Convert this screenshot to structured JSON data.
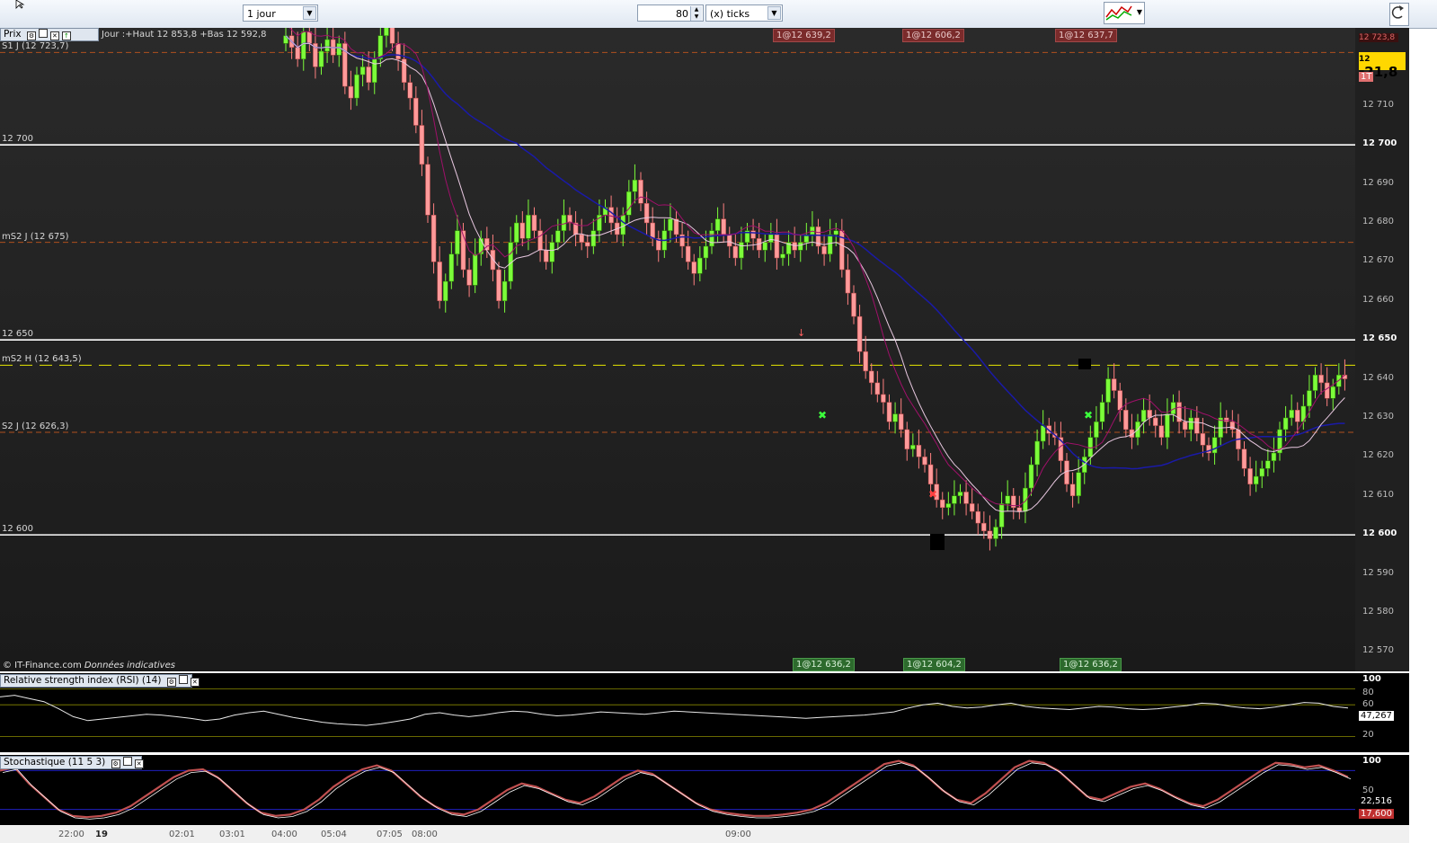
{
  "toolbar": {
    "period_select": "1 jour",
    "tick_count": "80",
    "tick_unit": "(x) ticks"
  },
  "price_panel": {
    "head_label": "Prix",
    "info": "Jour :+Haut 12 853,8 +Bas 12 592,8",
    "copyright": "© IT-Finance.com",
    "disclaimer": "Données indicatives",
    "last_price_prefix": "12 7",
    "last_price_big": "21,8",
    "top_red_value": "12 723,8",
    "timeframe_badge": "1T",
    "level_labels": [
      {
        "text": "S1 J (12 723,7)",
        "value": 12723.7
      },
      {
        "text": "12 700",
        "value": 12700
      },
      {
        "text": "mS2 J (12 675)",
        "value": 12675
      },
      {
        "text": "12 650",
        "value": 12650
      },
      {
        "text": "mS2 H (12 643,5)",
        "value": 12643.5
      },
      {
        "text": "S2 J (12 626,3)",
        "value": 12626.3
      },
      {
        "text": "12 600",
        "value": 12600
      }
    ],
    "trade_tags_top": [
      {
        "text": "1@12 639,2",
        "x_index": 119
      },
      {
        "text": "1@12 606,2",
        "x_index": 145
      },
      {
        "text": "1@12 637,7",
        "x_index": 175
      }
    ],
    "trade_tags_bottom": [
      {
        "text": "1@12 636,2",
        "x_index": 119
      },
      {
        "text": "1@12 604,2",
        "x_index": 145
      },
      {
        "text": "1@12 636,2",
        "x_index": 175
      }
    ],
    "y_ticks": [
      "12 710",
      "12 700",
      "12 690",
      "12 680",
      "12 670",
      "12 660",
      "12 650",
      "12 640",
      "12 630",
      "12 620",
      "12 610",
      "12 600",
      "12 590",
      "12 580",
      "12 570"
    ]
  },
  "rsi_panel": {
    "head_label": "Relative strength index (RSI) (14)",
    "current_value": "47,267",
    "y_ticks": [
      "100",
      "80",
      "60",
      "20"
    ]
  },
  "stoch_panel": {
    "head_label": "Stochastique (11 5 3)",
    "value_k": "22,516",
    "value_d": "17,600",
    "y_ticks": [
      "100",
      "50"
    ]
  },
  "time_axis": [
    "22:00",
    "19",
    "02:01",
    "03:01",
    "04:00",
    "05:04",
    "07:05",
    "08:00",
    "09:00"
  ],
  "chart_data": {
    "type": "candlestick",
    "ylim": [
      12565,
      12730
    ],
    "close_series": [
      12728,
      12725,
      12722,
      12729,
      12726,
      12720,
      12724,
      12727,
      12723,
      12726,
      12715,
      12712,
      12718,
      12720,
      12716,
      12722,
      12728,
      12732,
      12726,
      12722,
      12716,
      12712,
      12705,
      12695,
      12682,
      12670,
      12660,
      12665,
      12672,
      12678,
      12668,
      12664,
      12672,
      12676,
      12673,
      12668,
      12660,
      12665,
      12675,
      12680,
      12676,
      12682,
      12678,
      12673,
      12670,
      12675,
      12678,
      12682,
      12680,
      12677,
      12675,
      12674,
      12678,
      12682,
      12684,
      12680,
      12677,
      12682,
      12688,
      12691,
      12685,
      12680,
      12676,
      12673,
      12678,
      12681,
      12677,
      12674,
      12670,
      12667,
      12671,
      12674,
      12678,
      12681,
      12677,
      12674,
      12671,
      12675,
      12678,
      12676,
      12673,
      12675,
      12677,
      12671,
      12672,
      12675,
      12673,
      12675,
      12677,
      12679,
      12674,
      12672,
      12677,
      12678,
      12668,
      12662,
      12656,
      12647,
      12642,
      12639,
      12636,
      12634,
      12629,
      12631,
      12627,
      12622,
      12623,
      12620,
      12618,
      12613,
      12609,
      12607,
      12608,
      12610,
      12611,
      12608,
      12606,
      12603,
      12601,
      12599,
      12602,
      12608,
      12610,
      12607,
      12606,
      12612,
      12618,
      12624,
      12628,
      12626,
      12625,
      12619,
      12613,
      12610,
      12616,
      12620,
      12625,
      12629,
      12634,
      12640,
      12637,
      12632,
      12627,
      12625,
      12629,
      12632,
      12630,
      12628,
      12625,
      12631,
      12634,
      12629,
      12627,
      12630,
      12626,
      12623,
      12621,
      12625,
      12630,
      12629,
      12627,
      12622,
      12617,
      12613,
      12615,
      12617,
      12619,
      12621,
      12627,
      12630,
      12632,
      12629,
      12633,
      12637,
      12641,
      12639,
      12635,
      12638,
      12641,
      12640
    ],
    "rsi": [
      70,
      72,
      68,
      64,
      55,
      45,
      40,
      42,
      44,
      46,
      48,
      47,
      45,
      43,
      40,
      42,
      47,
      50,
      52,
      48,
      44,
      41,
      38,
      36,
      35,
      34,
      36,
      39,
      42,
      48,
      50,
      47,
      45,
      47,
      50,
      52,
      51,
      48,
      46,
      47,
      49,
      51,
      50,
      49,
      48,
      50,
      52,
      51,
      50,
      49,
      48,
      47,
      46,
      45,
      44,
      43,
      44,
      45,
      46,
      47,
      49,
      51,
      56,
      60,
      62,
      58,
      56,
      57,
      60,
      62,
      58,
      56,
      55,
      54,
      56,
      58,
      57,
      55,
      54,
      55,
      57,
      59,
      62,
      61,
      58,
      56,
      55,
      57,
      60,
      63,
      62,
      58,
      56
    ],
    "stoch_k": [
      80,
      85,
      60,
      40,
      20,
      10,
      8,
      10,
      15,
      25,
      40,
      55,
      70,
      80,
      82,
      70,
      50,
      30,
      15,
      10,
      12,
      20,
      35,
      55,
      70,
      82,
      88,
      80,
      60,
      40,
      25,
      15,
      12,
      20,
      35,
      50,
      60,
      55,
      45,
      35,
      30,
      40,
      55,
      70,
      80,
      75,
      60,
      45,
      30,
      20,
      15,
      12,
      10,
      10,
      12,
      15,
      20,
      30,
      45,
      60,
      75,
      90,
      95,
      88,
      70,
      50,
      35,
      30,
      45,
      65,
      85,
      95,
      92,
      80,
      60,
      40,
      35,
      45,
      55,
      60,
      52,
      40,
      30,
      25,
      35,
      50,
      65,
      80,
      92,
      90,
      85,
      88,
      80,
      70
    ]
  }
}
